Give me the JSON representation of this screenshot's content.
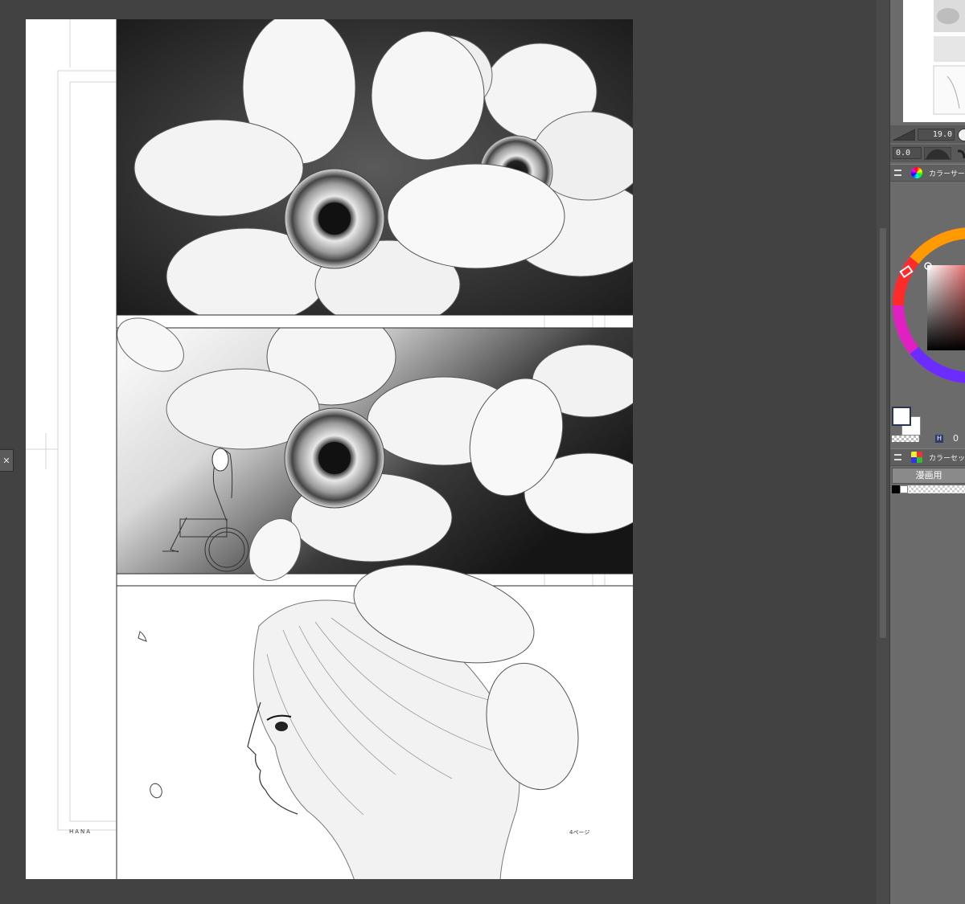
{
  "page": {
    "footer_left": "HANA",
    "footer_right": "4ページ"
  },
  "brush_size": {
    "value": "19.0"
  },
  "opacity": {
    "value": "0.0"
  },
  "color_circle": {
    "label": "カラーサークル",
    "hue_value": "0",
    "hue_letter": "H"
  },
  "color_set": {
    "label": "カラーセット",
    "tab": "漫画用"
  },
  "colors": {
    "main": "#ffffff",
    "sub": "#ffffff",
    "hue_marker": "#e03030"
  },
  "left_tab": {
    "icon": "close-icon",
    "glyph": "✕"
  }
}
